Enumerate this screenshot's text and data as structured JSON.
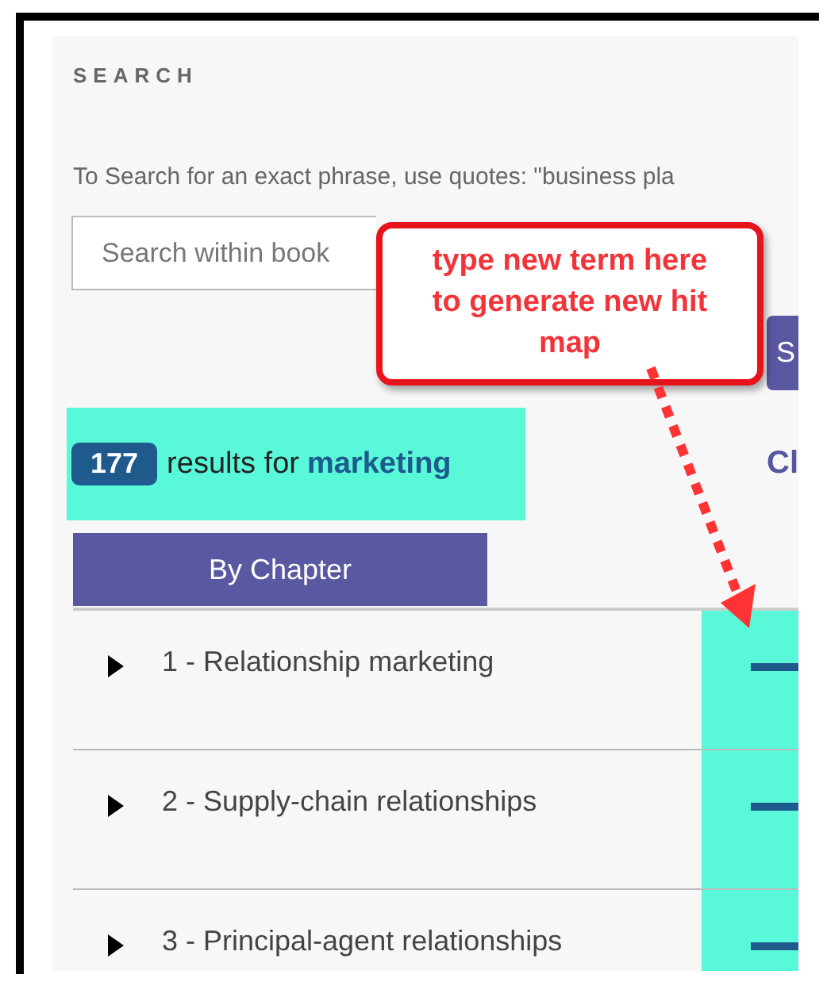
{
  "heading": "SEARCH",
  "hint": "To Search for an exact phrase, use quotes: \"business pla",
  "search": {
    "placeholder": "Search within book"
  },
  "search_button": "S",
  "callout": "type new term here to generate new hit map",
  "results": {
    "count": "177",
    "label": "results for",
    "term": "marketing"
  },
  "side_link": "Cl",
  "tabs": [
    {
      "label": "By Chapter",
      "selected": true
    }
  ],
  "chapters": [
    {
      "title": "1 - Relationship marketing",
      "expanded": false
    },
    {
      "title": "2 - Supply-chain relationships",
      "expanded": false
    },
    {
      "title": "3 - Principal-agent relationships",
      "expanded": false
    }
  ]
}
